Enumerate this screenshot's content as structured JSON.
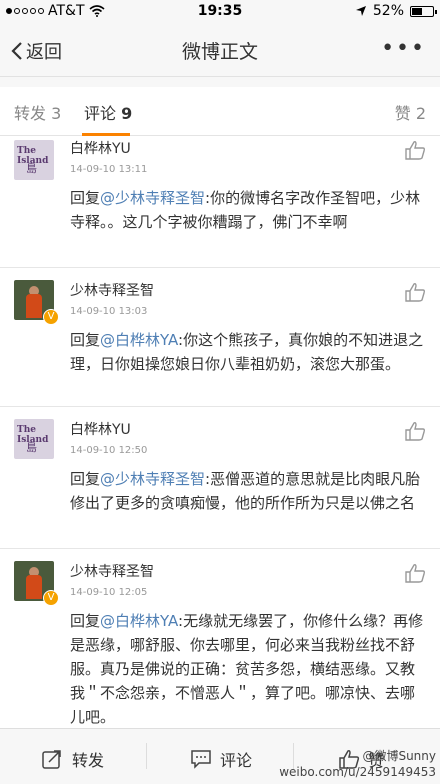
{
  "status": {
    "carrier": "AT&T",
    "time": "19:35",
    "battery": "52%",
    "battery_fraction": 0.52
  },
  "nav": {
    "back_label": "返回",
    "title": "微博正文",
    "more_label": "•••"
  },
  "tabs": [
    {
      "label": "转发",
      "count": "3"
    },
    {
      "label": "评论",
      "count": "9"
    },
    {
      "label": "赞",
      "count": "2"
    }
  ],
  "comments": [
    {
      "user": "白桦林YU",
      "time": "14-09-10 13:11",
      "avatar": "island",
      "reply_prefix": "回复",
      "mention": "@少林寺释圣智",
      "text": ":你的微博名字改作圣智吧，少林寺释。。这几个字被你糟蹋了，佛门不幸啊"
    },
    {
      "user": "少林寺释圣智",
      "time": "14-09-10 13:03",
      "avatar": "monk",
      "reply_prefix": "回复",
      "mention": "@白桦林YA",
      "text": ":你这个熊孩子，真你娘的不知进退之理，日你姐操您娘日你八辈祖奶奶，滚您大那蛋。"
    },
    {
      "user": "白桦林YU",
      "time": "14-09-10 12:50",
      "avatar": "island",
      "reply_prefix": "回复",
      "mention": "@少林寺释圣智",
      "text": ":恶僧恶道的意思就是比肉眼凡胎修出了更多的贪嗔痴慢，他的所作所为只是以佛之名"
    },
    {
      "user": "少林寺释圣智",
      "time": "14-09-10 12:05",
      "avatar": "monk",
      "reply_prefix": "回复",
      "mention": "@白桦林YA",
      "text": ":无缘就无缘罢了，你修什么缘？再修是恶缘，哪舒服、你去哪里，何必来当我粉丝找不舒服。真乃是佛说的正确：贫苦多怨，横结恶缘。又教我＂不念怨亲，不憎恶人＂，算了吧。哪凉快、去哪儿吧。"
    }
  ],
  "bottom": {
    "repost_label": "转发",
    "comment_label": "评论",
    "like_label": "赞"
  },
  "watermark": {
    "line1": "@微博Sunny",
    "line2": "weibo.com/u/2459149453"
  }
}
